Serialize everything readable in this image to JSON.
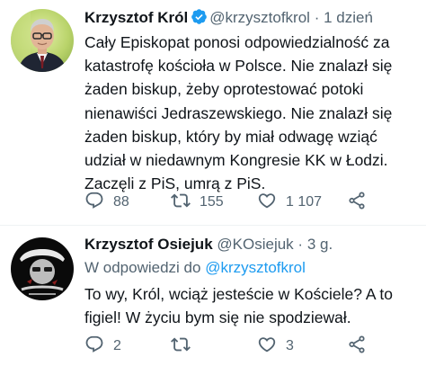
{
  "tweets": [
    {
      "author": "Krzysztof Król",
      "handle": "@krzysztofkrol",
      "separator": "·",
      "time": "1 dzień",
      "text": "Cały Episkopat ponosi odpowiedzialność za katastrofę kościoła w Polsce. Nie znalazł się żaden biskup, żeby oprotestować potoki nienawiści Jedraszewskiego. Nie znalazł się żaden biskup, który by miał odwagę wziąć udział w niedawnym Kongresie KK w Łodzi. Zaczęli z PiS, umrą z PiS.",
      "replies": "88",
      "retweets": "155",
      "likes": "1 107",
      "verified": true,
      "verified_color": "#1d9bf0"
    },
    {
      "author": "Krzysztof Osiejuk",
      "handle": "@KOsiejuk",
      "separator": "·",
      "time": "3 g.",
      "reply_prefix": "W odpowiedzi do",
      "reply_handle": "@krzysztofkrol",
      "text": "To wy, Król, wciąż jesteście w Kościele? A to figiel! W życiu bym się nie spodziewał.",
      "replies": "2",
      "retweets": "",
      "likes": "3"
    }
  ],
  "colors": {
    "text": "#0f1419",
    "secondary": "#536471",
    "link": "#1d9bf0",
    "divider": "#eff3f4"
  },
  "icons": [
    "reply-icon",
    "retweet-icon",
    "like-icon",
    "share-icon",
    "more-icon",
    "verified-badge-icon"
  ]
}
